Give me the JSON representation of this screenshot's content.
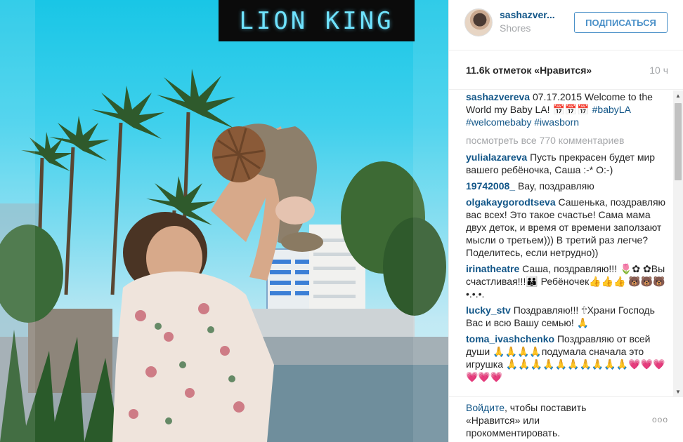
{
  "photo": {
    "title_text": "LION KING",
    "alt": "Instagram photo"
  },
  "header": {
    "username": "sashazver...",
    "location": "Shores",
    "follow_label": "ПОДПИСАТЬСЯ"
  },
  "stats": {
    "likes": "11.6k отметок «Нравится»",
    "time_ago": "10 ч"
  },
  "caption": {
    "user": "sashazvereva",
    "text": "07.17.2015 Welcome to the World my Baby LA! 📅📅📅",
    "tags": "#babyLA #welcomebaby #iwasborn"
  },
  "view_all": "посмотреть все 770 комментариев",
  "comments": [
    {
      "user": "yulialazareva",
      "text": "Пусть прекрасен будет мир вашего ребёночка, Саша :-* О:-)"
    },
    {
      "user": "19742008_",
      "text": "Вау, поздравляю"
    },
    {
      "user": "olgakaygorodtseva",
      "text": "Сашенька, поздравляю вас всех! Это такое счастье! Сама мама двух деток, и время от времени заползают мысли о третьем))) В третий раз легче? Поделитесь, если нетрудно))"
    },
    {
      "user": "irinatheatre",
      "text": "Саша, поздравляю!!! 🌷✿ ✿Вы счастливая!!!👪 Ребёночек👍👍👍 🐻🐻🐻•.•.•."
    },
    {
      "user": "lucky_stv",
      "text": "Поздравляю!!! 🕆Храни Господь Вас и всю Вашу семью! 🙏"
    },
    {
      "user": "toma_ivashchenko",
      "text": "Поздравляю от всей души 🙏🙏🙏🙏подумала сначала это игрушка 🙏🙏🙏🙏🙏🙏🙏🙏🙏🙏💗💗💗💗💗💗"
    }
  ],
  "footer": {
    "login_link": "Войдите",
    "login_rest": ", чтобы поставить «Нравится» или прокомментировать.",
    "more": "ooo"
  },
  "colors": {
    "link": "#125688",
    "muted": "#a5a7aa",
    "follow_border": "#4a90c8",
    "title_text": "#6fe3ff"
  }
}
